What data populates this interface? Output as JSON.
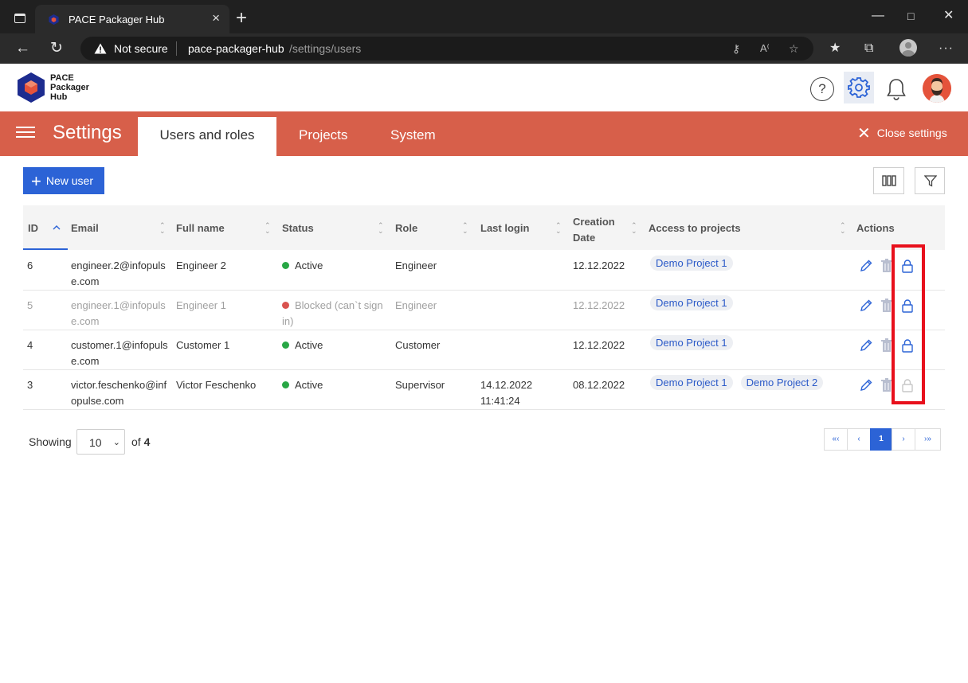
{
  "browser": {
    "tab_title": "PACE Packager Hub",
    "tab_close": "×",
    "new_tab": "+",
    "security_label": "Not secure",
    "url_host": "pace-packager-hub",
    "url_path": "/settings/users",
    "icons": [
      "window-icon",
      "back-arrow-icon",
      "refresh-icon",
      "key-icon",
      "read-aloud-icon",
      "favorite-add-icon",
      "favorites-icon",
      "collections-icon",
      "profile-icon",
      "more-icon"
    ]
  },
  "app": {
    "logo_lines": [
      "PACE",
      "Packager",
      "Hub"
    ],
    "help_glyph": "?"
  },
  "settings": {
    "title": "Settings",
    "tabs": [
      {
        "label": "Users and roles",
        "active": true
      },
      {
        "label": "Projects",
        "active": false
      },
      {
        "label": "System",
        "active": false
      }
    ],
    "close_label": "Close settings",
    "close_glyph": "✕"
  },
  "toolbar": {
    "new_user_label": "New user",
    "plus_glyph": "+"
  },
  "table": {
    "columns": [
      "ID",
      "Email",
      "Full name",
      "Status",
      "Role",
      "Last login",
      "Creation Date",
      "Access to projects",
      "Actions"
    ],
    "creation_date_lines": [
      "Creation",
      "Date"
    ],
    "rows": [
      {
        "id": "6",
        "email_lines": [
          "engineer.2@infopuls",
          "e.com"
        ],
        "full_name": "Engineer 2",
        "status_lines": [
          "Active",
          ""
        ],
        "status_color": "#28a745",
        "role": "Engineer",
        "last_login_lines": [
          "",
          ""
        ],
        "creation_date": "12.12.2022",
        "projects": [
          "Demo Project 1"
        ],
        "dim": false,
        "lock_enabled": true
      },
      {
        "id": "5",
        "email_lines": [
          "engineer.1@infopuls",
          "e.com"
        ],
        "full_name": "Engineer 1",
        "status_lines": [
          "Blocked (can`t sign",
          "in)"
        ],
        "status_color": "#d9534f",
        "role": "Engineer",
        "last_login_lines": [
          "",
          ""
        ],
        "creation_date": "12.12.2022",
        "projects": [
          "Demo Project 1"
        ],
        "dim": true,
        "lock_enabled": true
      },
      {
        "id": "4",
        "email_lines": [
          "customer.1@infopuls",
          "e.com"
        ],
        "full_name": "Customer 1",
        "status_lines": [
          "Active",
          ""
        ],
        "status_color": "#28a745",
        "role": "Customer",
        "last_login_lines": [
          "",
          ""
        ],
        "creation_date": "12.12.2022",
        "projects": [
          "Demo Project 1"
        ],
        "dim": false,
        "lock_enabled": true
      },
      {
        "id": "3",
        "email_lines": [
          "victor.feschenko@inf",
          "opulse.com"
        ],
        "full_name": "Victor Feschenko",
        "status_lines": [
          "Active",
          ""
        ],
        "status_color": "#28a745",
        "role": "Supervisor",
        "last_login_lines": [
          "14.12.2022",
          "11:41:24"
        ],
        "creation_date": "08.12.2022",
        "projects": [
          "Demo Project 1",
          "Demo Project 2"
        ],
        "dim": false,
        "lock_enabled": false
      }
    ]
  },
  "pagination": {
    "showing_label": "Showing",
    "page_size": "10",
    "of_label": "of",
    "total": "4",
    "buttons": [
      "«‹",
      "‹",
      "1",
      "›",
      "›»"
    ]
  },
  "colors": {
    "accent": "#2c63d6",
    "settings_bar": "#d75f4a",
    "highlight_box": "#e8101c"
  }
}
